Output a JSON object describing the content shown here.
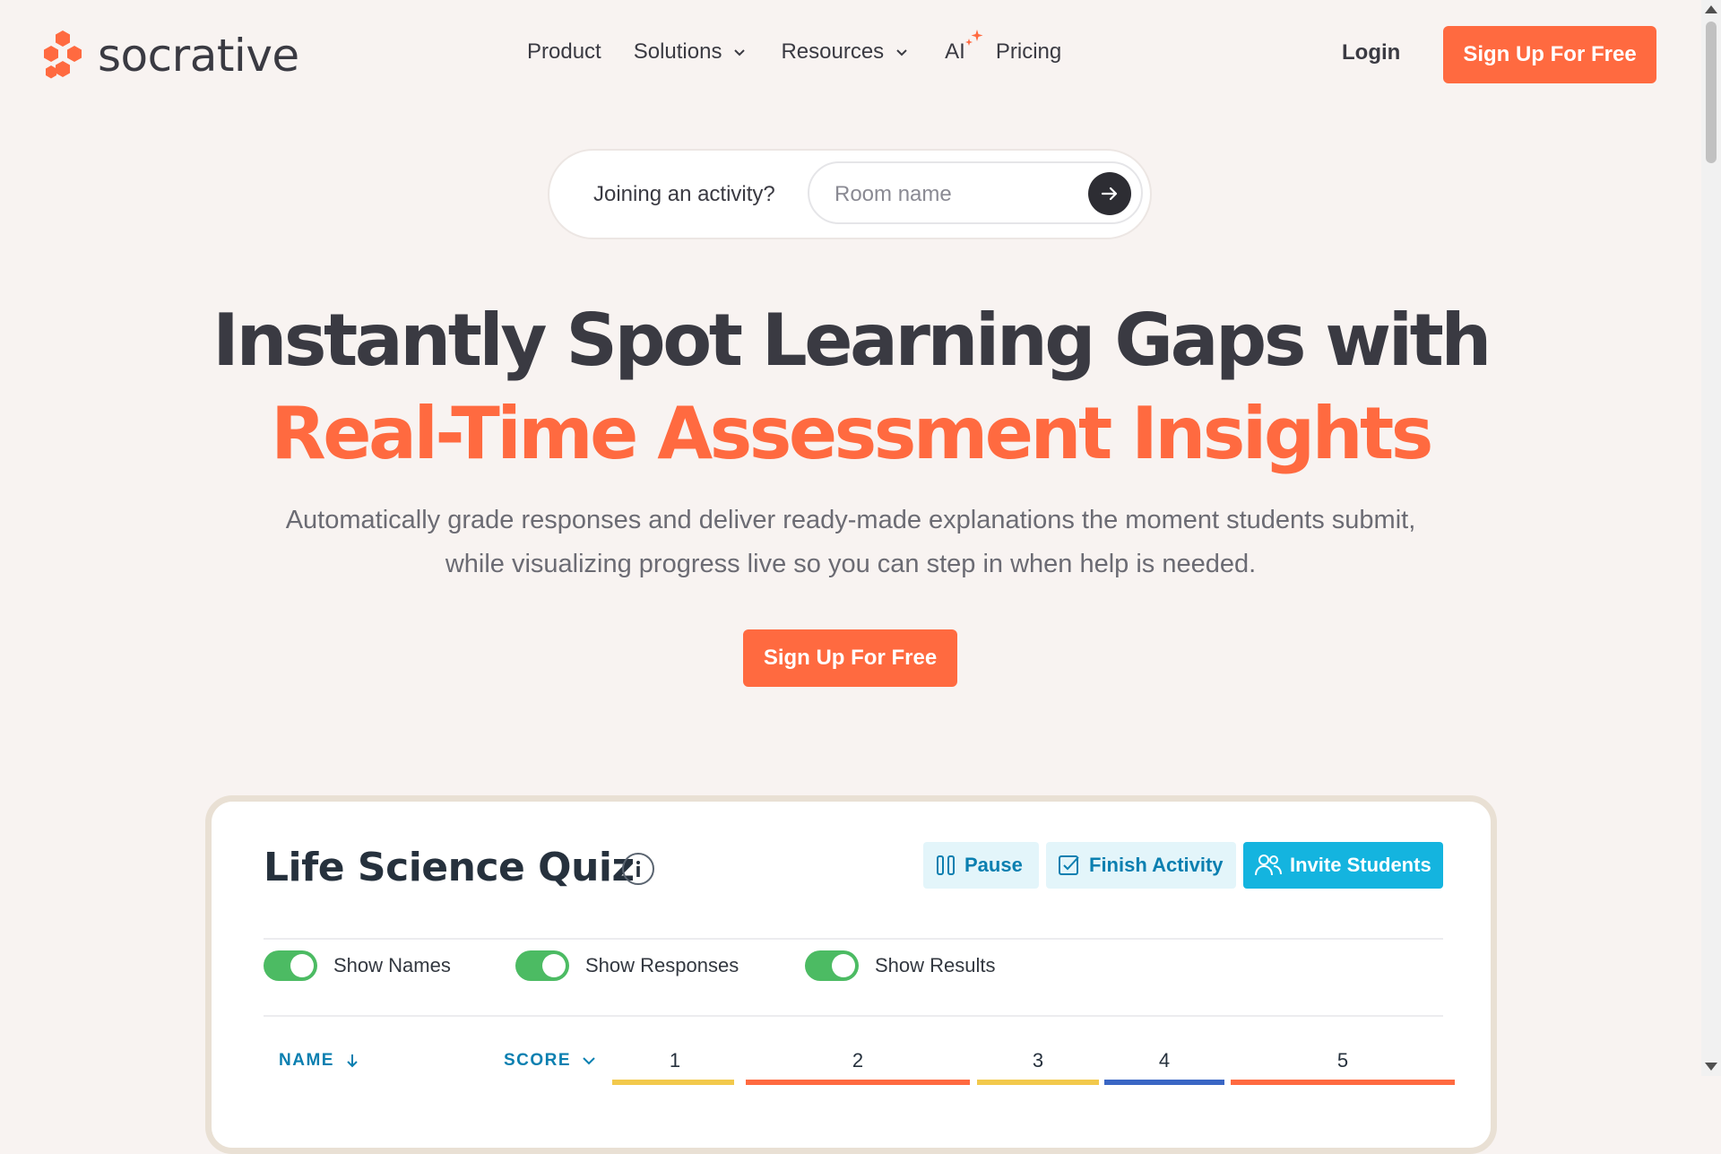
{
  "brand": {
    "name": "socrative",
    "accent": "#ff6a40"
  },
  "nav": {
    "product": "Product",
    "solutions": "Solutions",
    "resources": "Resources",
    "ai": "AI",
    "pricing": "Pricing",
    "login": "Login",
    "signup": "Sign Up For Free"
  },
  "join": {
    "label": "Joining an activity?",
    "placeholder": "Room name",
    "submit_icon": "arrow-right-icon"
  },
  "hero": {
    "headline_line1": "Instantly Spot Learning Gaps with",
    "headline_line2": "Real-Time Assessment Insights",
    "subtitle": "Automatically grade responses and deliver ready-made explanations the moment students submit, while visualizing progress live so you can step in when help is needed.",
    "cta": "Sign Up For Free"
  },
  "demo": {
    "title": "Life Science Quiz",
    "actions": {
      "pause": "Pause",
      "finish": "Finish Activity",
      "invite": "Invite Students"
    },
    "toggles": [
      {
        "label": "Show Names",
        "on": true
      },
      {
        "label": "Show Responses",
        "on": true
      },
      {
        "label": "Show Results",
        "on": true
      }
    ],
    "columns": {
      "name": "NAME",
      "score": "SCORE"
    },
    "questions": [
      "1",
      "2",
      "3",
      "4",
      "5"
    ],
    "question_bar_colors": [
      "#f2c94c",
      "#ff6a40",
      "#f2c94c",
      "#3a66c4",
      "#ff6a40"
    ]
  }
}
